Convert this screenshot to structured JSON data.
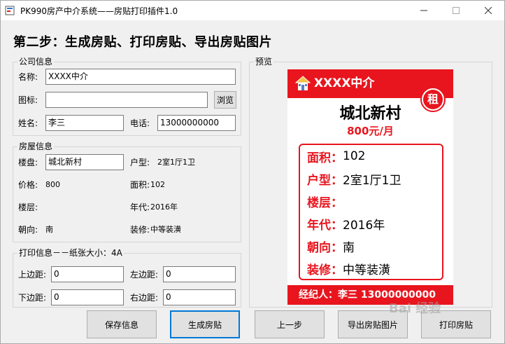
{
  "window": {
    "title": "PK990房产中介系统——房贴打印插件1.0",
    "minimize": "—",
    "maximize": "☐",
    "close": "✕"
  },
  "step_title": "第二步：生成房贴、打印房贴、导出房贴图片",
  "company": {
    "legend": "公司信息",
    "name_label": "名称:",
    "name_value": "XXXX中介",
    "icon_label": "图标:",
    "icon_value": "",
    "browse_button": "浏览",
    "contact_label": "姓名:",
    "contact_value": "李三",
    "phone_label": "电话:",
    "phone_value": "13000000000"
  },
  "house": {
    "legend": "房屋信息",
    "estate_label": "楼盘:",
    "estate_value": "城北新村",
    "layout_label": "户型:",
    "layout_value": "2室1厅1卫",
    "price_label": "价格:",
    "price_value": "800",
    "area_label": "面积:",
    "area_value": "102",
    "floor_label": "楼层:",
    "floor_value": "",
    "year_label": "年代:",
    "year_value": "2016年",
    "orientation_label": "朝向:",
    "orientation_value": "南",
    "decoration_label": "装修:",
    "decoration_value": "中等装潢"
  },
  "print": {
    "legend": "打印信息－－纸张大小：4A",
    "top_label": "上边距:",
    "top_value": "0",
    "left_label": "左边距:",
    "left_value": "0",
    "bottom_label": "下边距:",
    "bottom_value": "0",
    "right_label": "右边距:",
    "right_value": "0"
  },
  "preview": {
    "legend": "预览",
    "company": "XXXX中介",
    "rent_badge": "租",
    "estate": "城北新村",
    "price": "800元/月",
    "rows": [
      {
        "key": "面积：",
        "value": "102"
      },
      {
        "key": "户型：",
        "value": "2室1厅1卫"
      },
      {
        "key": "楼层：",
        "value": ""
      },
      {
        "key": "年代：",
        "value": "2016年"
      },
      {
        "key": "朝向：",
        "value": "南"
      },
      {
        "key": "装修：",
        "value": "中等装潢"
      }
    ],
    "agent": "经纪人：李三  13000000000",
    "accent": "#e8151e"
  },
  "buttons": {
    "save": "保存信息",
    "generate": "生成房贴",
    "prev": "上一步",
    "export": "导出房贴图片",
    "print": "打印房贴"
  },
  "watermark": "Bai 经验"
}
